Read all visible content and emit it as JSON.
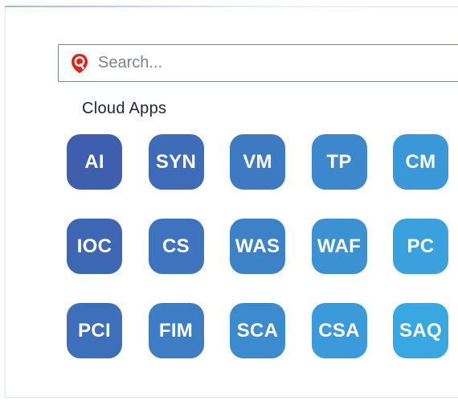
{
  "search": {
    "placeholder": "Search...",
    "logo_icon": "qualys-shield-icon",
    "logo_color": "#e2231a"
  },
  "section_title": "Cloud Apps",
  "colors": {
    "tile_dark": "#3d5cad",
    "tile_light": "#3ca4df"
  },
  "apps": [
    {
      "label": "AI",
      "color": "#3f5ead"
    },
    {
      "label": "SYN",
      "color": "#3e6cb8"
    },
    {
      "label": "VM",
      "color": "#3e7ac2"
    },
    {
      "label": "TP",
      "color": "#3d88cc"
    },
    {
      "label": "CM",
      "color": "#3b98d8"
    },
    {
      "label": "IOC",
      "color": "#3d66b3"
    },
    {
      "label": "CS",
      "color": "#3e74bd"
    },
    {
      "label": "WAS",
      "color": "#3d82c7"
    },
    {
      "label": "WAF",
      "color": "#3c91d2"
    },
    {
      "label": "PC",
      "color": "#3aa1de"
    },
    {
      "label": "PCI",
      "color": "#3d6fba"
    },
    {
      "label": "FIM",
      "color": "#3d7dc4"
    },
    {
      "label": "SCA",
      "color": "#3c8bce"
    },
    {
      "label": "CSA",
      "color": "#3b9ad9"
    },
    {
      "label": "SAQ",
      "color": "#39a8e2"
    }
  ]
}
